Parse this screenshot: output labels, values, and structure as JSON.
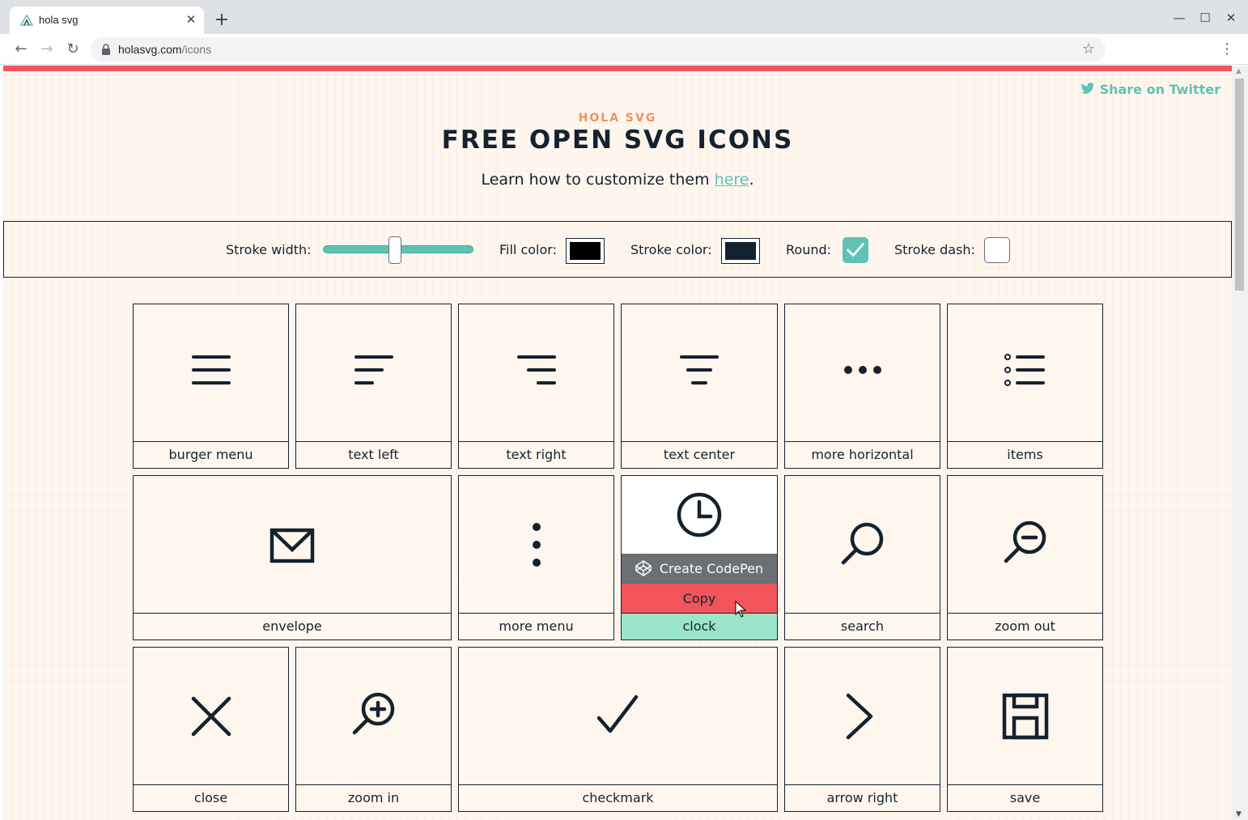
{
  "browser": {
    "tab_title": "hola svg",
    "tab_close": "✕",
    "new_tab": "+",
    "url_host": "holasvg.com",
    "url_path": "/icons",
    "window_minimize": "—",
    "window_maximize": "☐",
    "window_close": "✕"
  },
  "header": {
    "share_label": "Share on Twitter",
    "eyebrow": "HOLA SVG",
    "title": "FREE OPEN SVG ICONS",
    "subtitle_prefix": "Learn how to customize them ",
    "subtitle_link": "here",
    "subtitle_suffix": "."
  },
  "controls": {
    "stroke_width_label": "Stroke width:",
    "stroke_width_value": 0.48,
    "fill_color_label": "Fill color:",
    "fill_color": "#000000",
    "stroke_color_label": "Stroke color:",
    "stroke_color": "#14222f",
    "round_label": "Round:",
    "round_checked": true,
    "stroke_dash_label": "Stroke dash:",
    "stroke_dash_checked": false
  },
  "icons": [
    {
      "label": "burger menu",
      "icon": "burger-menu-icon"
    },
    {
      "label": "text left",
      "icon": "text-left-icon"
    },
    {
      "label": "text right",
      "icon": "text-right-icon"
    },
    {
      "label": "text center",
      "icon": "text-center-icon"
    },
    {
      "label": "more horizontal",
      "icon": "more-horizontal-icon"
    },
    {
      "label": "items",
      "icon": "items-icon"
    },
    {
      "label": "envelope",
      "icon": "envelope-icon"
    },
    {
      "label": "more menu",
      "icon": "more-menu-icon"
    },
    {
      "label": "clock",
      "icon": "clock-icon"
    },
    {
      "label": "search",
      "icon": "search-icon"
    },
    {
      "label": "zoom out",
      "icon": "zoom-out-icon"
    },
    {
      "label": "close",
      "icon": "close-icon"
    },
    {
      "label": "zoom in",
      "icon": "zoom-in-icon"
    },
    {
      "label": "checkmark",
      "icon": "checkmark-icon"
    },
    {
      "label": "arrow right",
      "icon": "arrow-right-icon"
    },
    {
      "label": "save",
      "icon": "save-icon"
    }
  ],
  "hover_menu": {
    "codepen_label": "Create CodePen",
    "copy_label": "Copy"
  },
  "colors": {
    "accent_red": "#f2545b",
    "accent_teal": "#5fc2b4",
    "accent_orange": "#f0925f",
    "ink": "#14222f",
    "background": "#fff7ee",
    "hover_label": "#9ce4cc"
  }
}
